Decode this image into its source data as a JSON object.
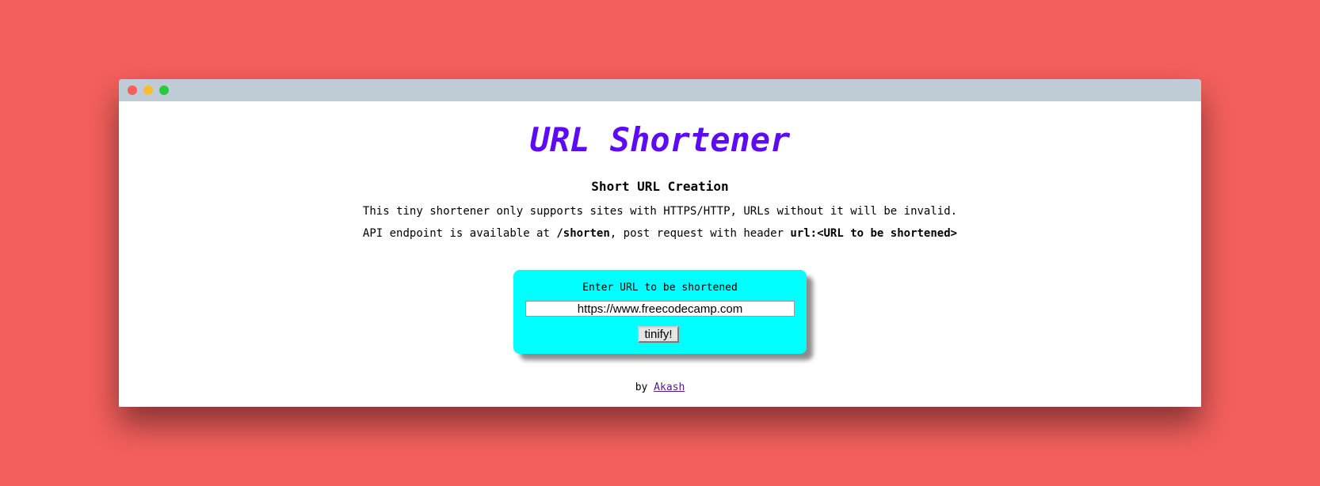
{
  "window": {
    "controls": [
      "close",
      "minimize",
      "maximize"
    ],
    "colors": {
      "background": "#f35f5c",
      "titlebar": "#bfccd6",
      "close": "#fc5f57",
      "minimize": "#fdbc2e",
      "maximize": "#28c840"
    }
  },
  "page": {
    "title": "URL Shortener",
    "title_color": "#5c0bf2",
    "subtitle": "Short URL Creation",
    "description": "This tiny shortener only supports sites with HTTPS/HTTP, URLs without it will be invalid.",
    "api": {
      "prefix": "API endpoint is available at ",
      "endpoint": "/shorten",
      "middle": ", post request with header ",
      "header": "url:<URL to be shortened>"
    }
  },
  "form": {
    "label": "Enter URL to be shortened",
    "url_value": "https://www.freecodecamp.com",
    "button_label": "tinify!",
    "card_color": "#00ffff"
  },
  "footer": {
    "by": "by ",
    "author": "Akash"
  }
}
